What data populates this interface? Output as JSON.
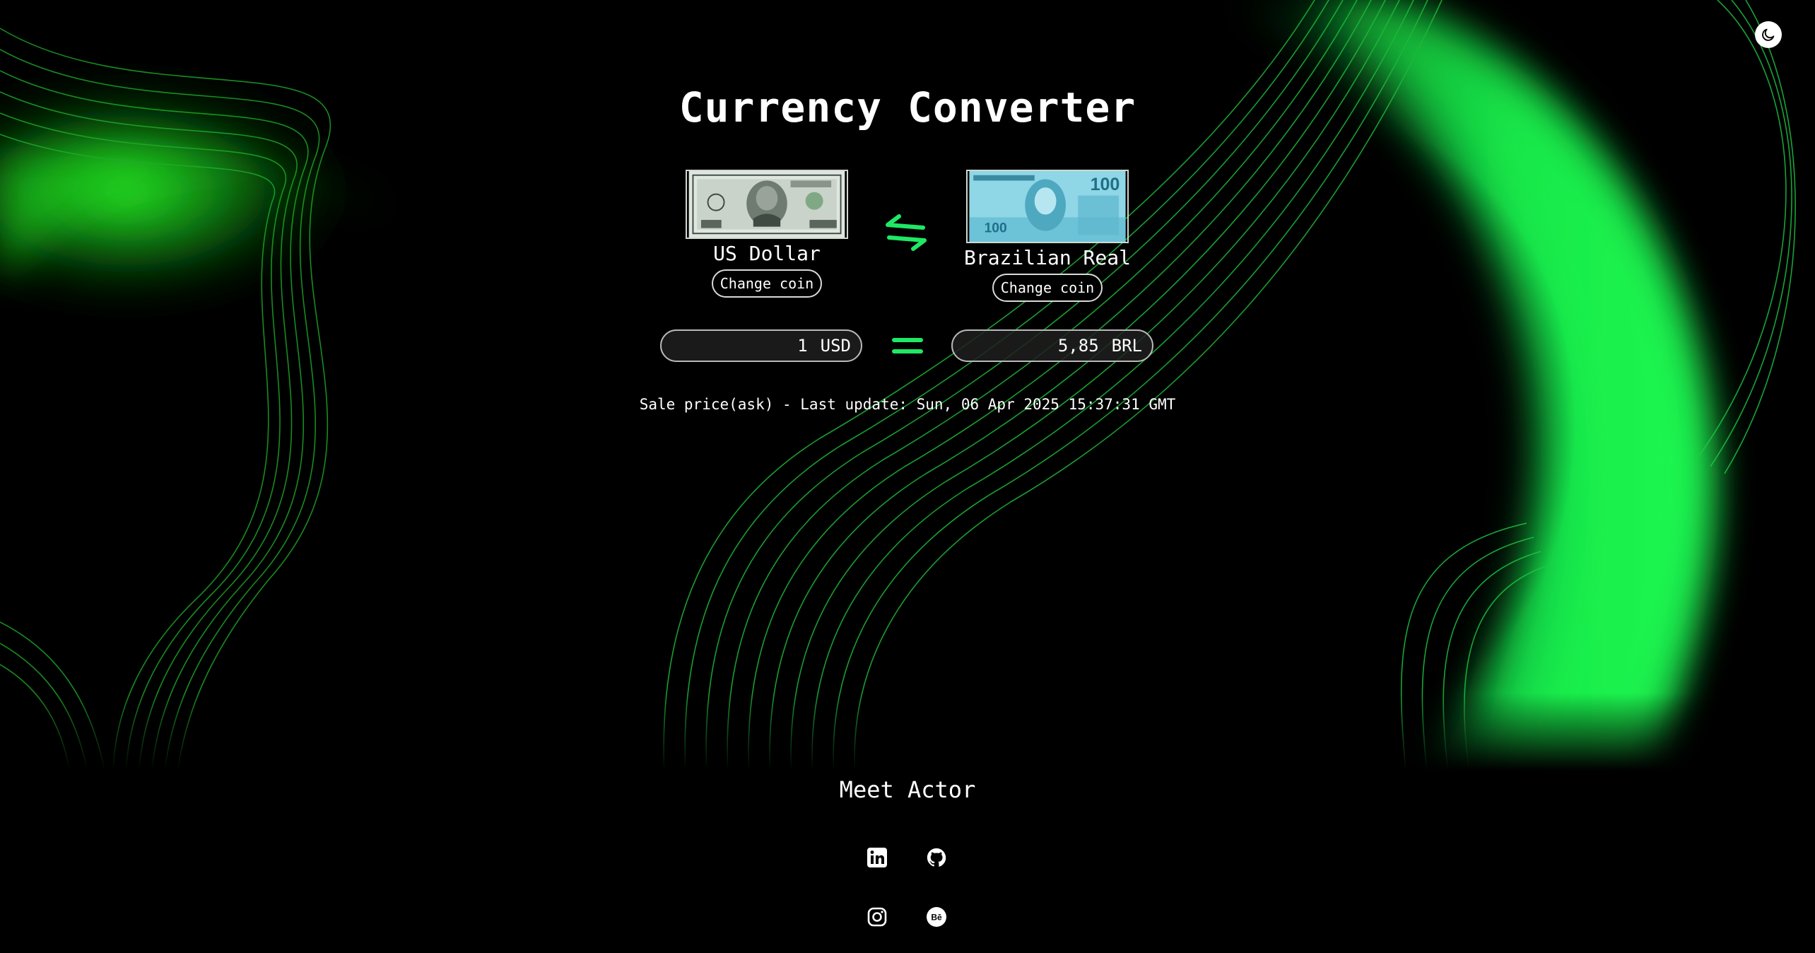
{
  "header": {
    "title": "Currency Converter",
    "theme_toggle_icon": "moon-icon"
  },
  "converter": {
    "from": {
      "name": "US Dollar",
      "change_label": "Change coin",
      "amount": "1",
      "code": "USD"
    },
    "to": {
      "name": "Brazilian Real",
      "change_label": "Change coin",
      "amount": "5,85",
      "code": "BRL"
    },
    "swap_icon": "swap-arrows-icon",
    "equals_icon": "equals-icon",
    "update_text": "Sale price(ask) - Last update: Sun, 06 Apr 2025 15:37:31 GMT"
  },
  "footer": {
    "title": "Meet Actor",
    "links": [
      "linkedin-icon",
      "github-icon",
      "instagram-icon",
      "behance-icon"
    ]
  },
  "colors": {
    "accent": "#1fe865",
    "background": "#000000"
  }
}
